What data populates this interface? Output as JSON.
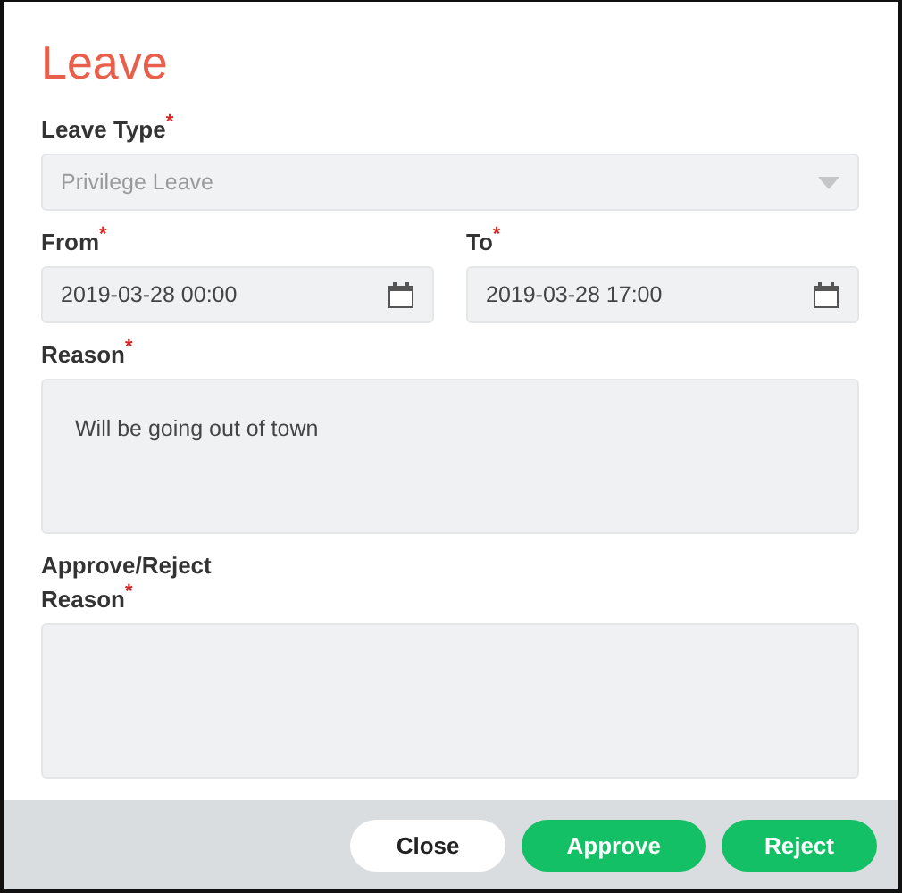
{
  "dialog": {
    "title": "Leave"
  },
  "fields": [
    {
      "kind": "select",
      "label": "Leave Type",
      "required_mark": "*",
      "value": "Privilege Leave",
      "disabled": true
    },
    {
      "kind": "datetime",
      "label": "From",
      "required_mark": "*",
      "value": "2019-03-28 00:00"
    },
    {
      "kind": "datetime",
      "label": "To",
      "required_mark": "*",
      "value": "2019-03-28 17:00"
    },
    {
      "kind": "textarea",
      "label": "Reason",
      "required_mark": "*",
      "value": "Will be going out of town"
    },
    {
      "kind": "textarea",
      "label": "Approve/Reject Reason",
      "required_mark": "*"
    }
  ],
  "buttons": [
    {
      "label": "Close",
      "kind": "secondary"
    },
    {
      "label": "Approve",
      "kind": "primary"
    },
    {
      "label": "Reject",
      "kind": "primary"
    }
  ]
}
